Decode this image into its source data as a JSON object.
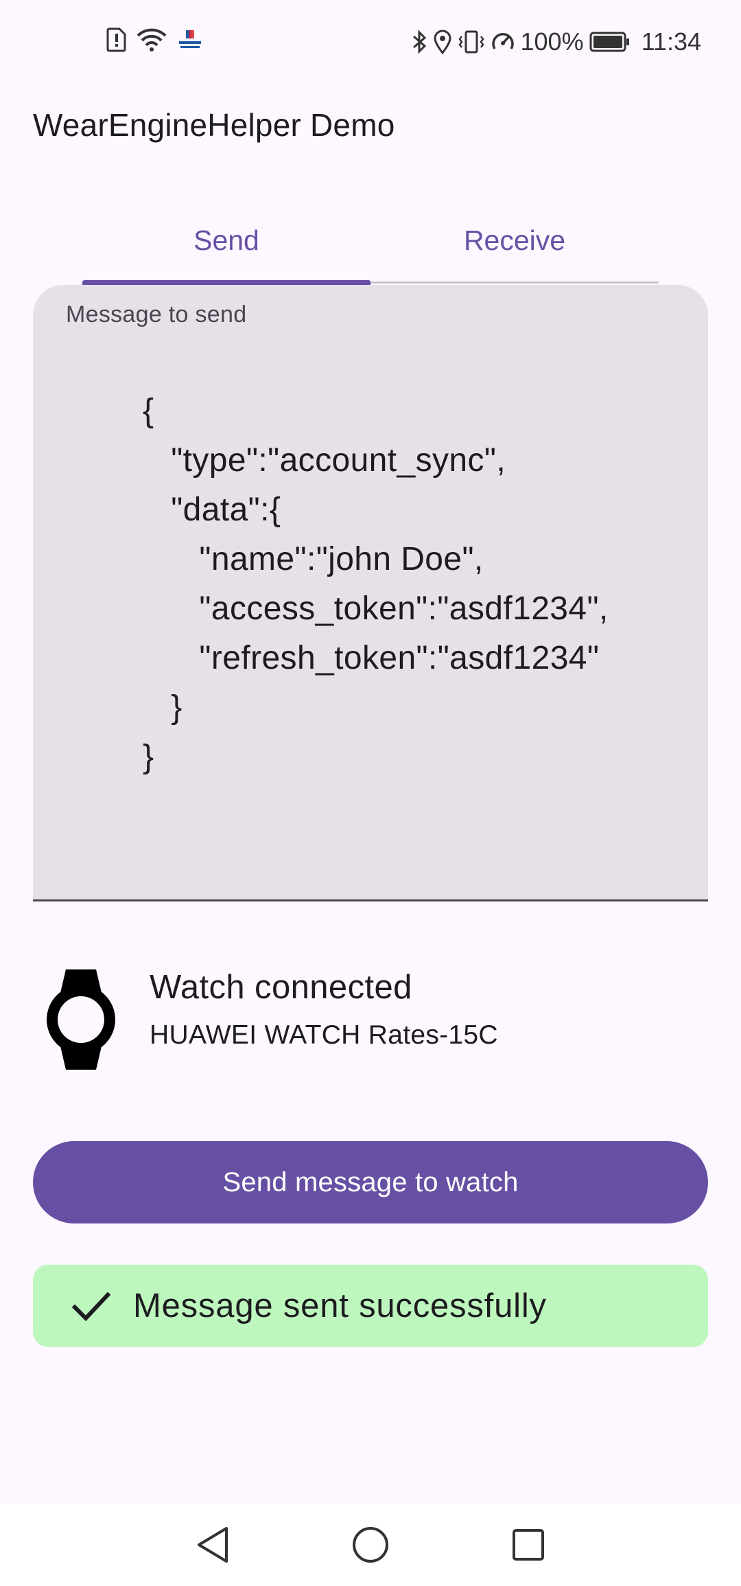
{
  "status_bar": {
    "icons_left": [
      "sim-alert-icon",
      "wifi-icon",
      "carrefour-app-icon"
    ],
    "icons_right": [
      "bluetooth-icon",
      "location-icon",
      "vibrate-icon",
      "data-saver-icon",
      "battery-icon"
    ],
    "battery_percent": "100%",
    "time": "11:34"
  },
  "app_bar": {
    "title": "WearEngineHelper Demo"
  },
  "tabs": {
    "items": [
      {
        "label": "Send",
        "selected": true
      },
      {
        "label": "Receive",
        "selected": false
      }
    ],
    "accent_color": "#6750a4"
  },
  "message_field": {
    "label": "Message to send",
    "value": "{\n   \"type\":\"account_sync\",\n   \"data\":{\n      \"name\":\"john Doe\",\n      \"access_token\":\"asdf1234\",\n      \"refresh_token\":\"asdf1234\"\n   }\n}"
  },
  "device": {
    "icon": "watch-icon",
    "status": "Watch connected",
    "name": "HUAWEI WATCH Rates-15C"
  },
  "send_button": {
    "label": "Send message to watch",
    "color": "#6750a4"
  },
  "result": {
    "icon": "check-icon",
    "text": "Message sent successfully",
    "color": "#bdf7be"
  },
  "nav_bar": {
    "buttons": [
      "back-icon",
      "home-icon",
      "recents-icon"
    ]
  }
}
